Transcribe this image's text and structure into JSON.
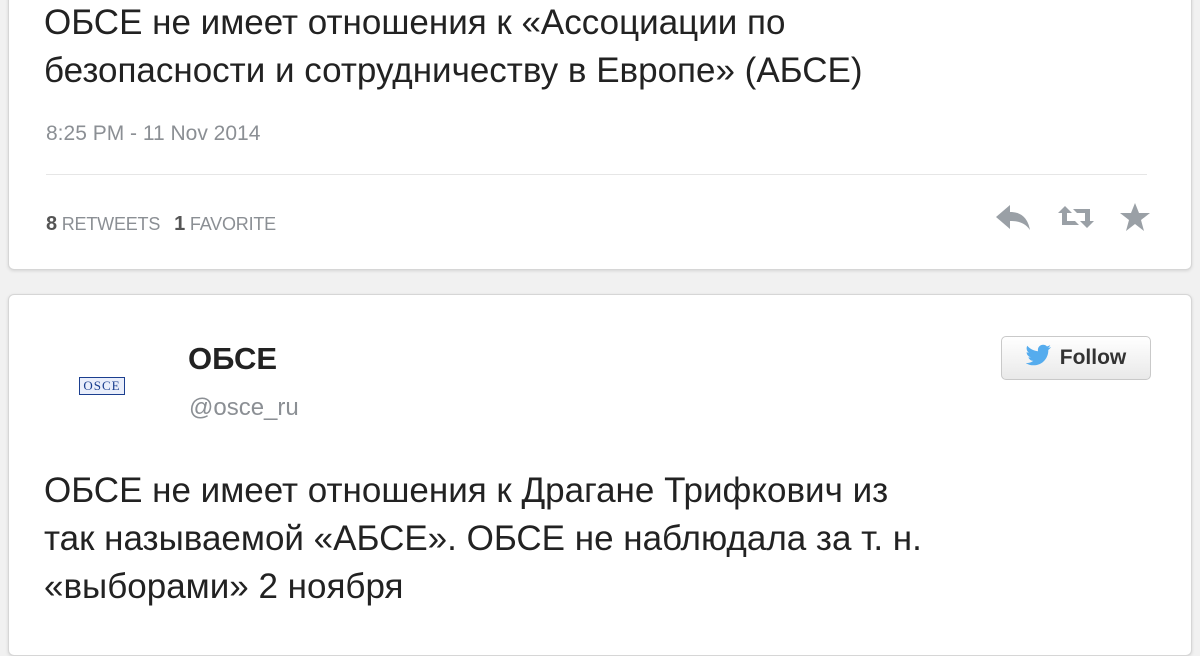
{
  "tweet1": {
    "text_lines": [
      "ОБСЕ не имеет отношения к «Ассоциации по",
      "безопасности и сотрудничеству в Европе» (АБСЕ)"
    ],
    "timestamp": "8:25 PM - 11 Nov 2014",
    "retweets_count": "8",
    "retweets_label": "RETWEETS",
    "favorites_count": "1",
    "favorites_label": "FAVORITE"
  },
  "tweet2": {
    "author": {
      "avatar_text": "OSCE",
      "display_name": "ОБСЕ",
      "handle": "@osce_ru"
    },
    "follow_label": "Follow",
    "text_lines": [
      "ОБСЕ не имеет отношения к Драгане Трифкович из",
      "так называемой «АБСЕ». ОБСЕ не наблюдала за т. н.",
      "«выборами» 2 ноября"
    ]
  },
  "icons": {
    "reply": "reply-icon",
    "retweet": "retweet-icon",
    "favorite": "star-icon",
    "follow": "twitter-bird-icon"
  },
  "colors": {
    "text": "#222222",
    "muted": "#8b8f94",
    "twitter_blue": "#55acee",
    "osce_blue": "#1b3f8f"
  }
}
